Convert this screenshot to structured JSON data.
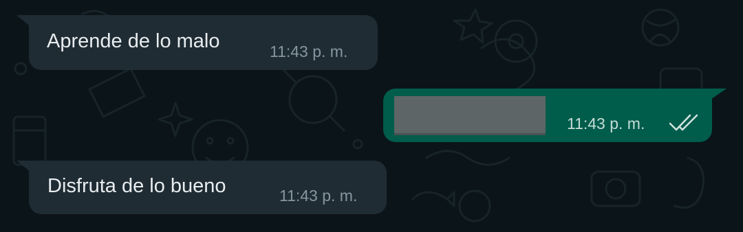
{
  "messages": [
    {
      "direction": "incoming",
      "text": "Aprende de lo malo",
      "time": "11:43 p. m."
    },
    {
      "direction": "outgoing",
      "text": "",
      "time": "11:43 p. m.",
      "redacted": true,
      "status_icon": "double-check-icon"
    },
    {
      "direction": "incoming",
      "text": "Disfruta de lo bueno",
      "time": "11:43 p. m."
    }
  ],
  "colors": {
    "background": "#0b1419",
    "incoming_bubble": "#1f2c34",
    "outgoing_bubble": "#005c4b",
    "text": "#e9edef",
    "timestamp": "#8696a0",
    "check": "#d0e2dd"
  }
}
